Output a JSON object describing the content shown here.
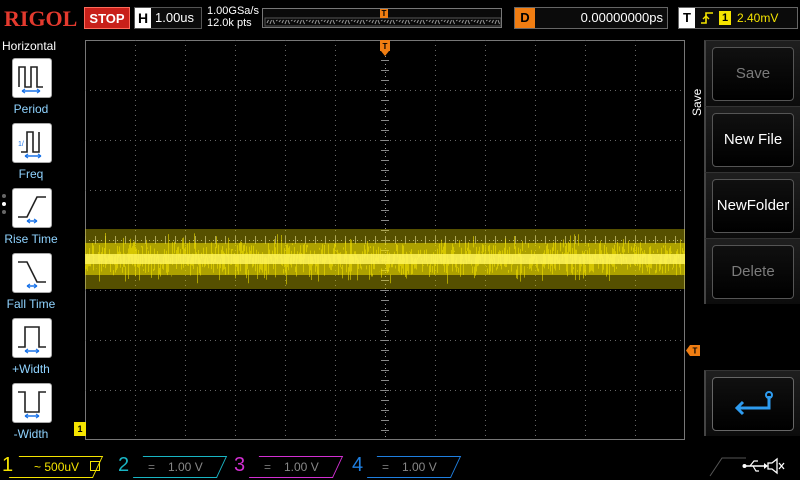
{
  "topbar": {
    "brand": "RIGOL",
    "run_state": "STOP",
    "horizontal_label": "H",
    "timebase": "1.00us",
    "sample_rate": "1.00GSa/s",
    "mem_depth": "12.0k pts",
    "trigger_marker": "T",
    "delay_label": "D",
    "delay_value": "0.00000000ps",
    "trigger_label": "T",
    "trigger_source": "1",
    "trigger_level": "2.40mV"
  },
  "left_panel": {
    "title": "Horizontal",
    "items": [
      {
        "label": "Period",
        "icon": "period-icon"
      },
      {
        "label": "Freq",
        "icon": "frequency-icon"
      },
      {
        "label": "Rise Time",
        "icon": "rise-time-icon"
      },
      {
        "label": "Fall Time",
        "icon": "fall-time-icon"
      },
      {
        "label": "+Width",
        "icon": "positive-width-icon"
      },
      {
        "label": "-Width",
        "icon": "negative-width-icon"
      }
    ]
  },
  "display": {
    "trigger_position_marker": "T",
    "trigger_level_marker": "T",
    "channel_marker": "1",
    "trace_color": "#f5e400"
  },
  "right_menu": {
    "title": "Save",
    "buttons": [
      {
        "label": "Save",
        "enabled": false
      },
      {
        "label": "New File",
        "enabled": true
      },
      {
        "label": "NewFolder",
        "enabled": true
      },
      {
        "label": "Delete",
        "enabled": false
      },
      {
        "label": "",
        "icon": "return-arrow-icon",
        "enabled": true
      }
    ]
  },
  "channels": [
    {
      "number": "1",
      "value": "500uV",
      "coupling": "~",
      "color": "#f5e400",
      "active": true
    },
    {
      "number": "2",
      "value": "1.00 V",
      "coupling": "=",
      "color": "#19b5c4",
      "active": false
    },
    {
      "number": "3",
      "value": "1.00 V",
      "coupling": "=",
      "color": "#d22fd2",
      "active": false
    },
    {
      "number": "4",
      "value": "1.00 V",
      "coupling": "=",
      "color": "#1f7fe0",
      "active": false
    }
  ],
  "status_icons": [
    "usb-icon",
    "speaker-mute-icon"
  ],
  "colors": {
    "brand": "#e43a2e",
    "stop": "#c8201a",
    "trigger": "#f07d12",
    "menu_text_active": "#8fd3ff"
  }
}
